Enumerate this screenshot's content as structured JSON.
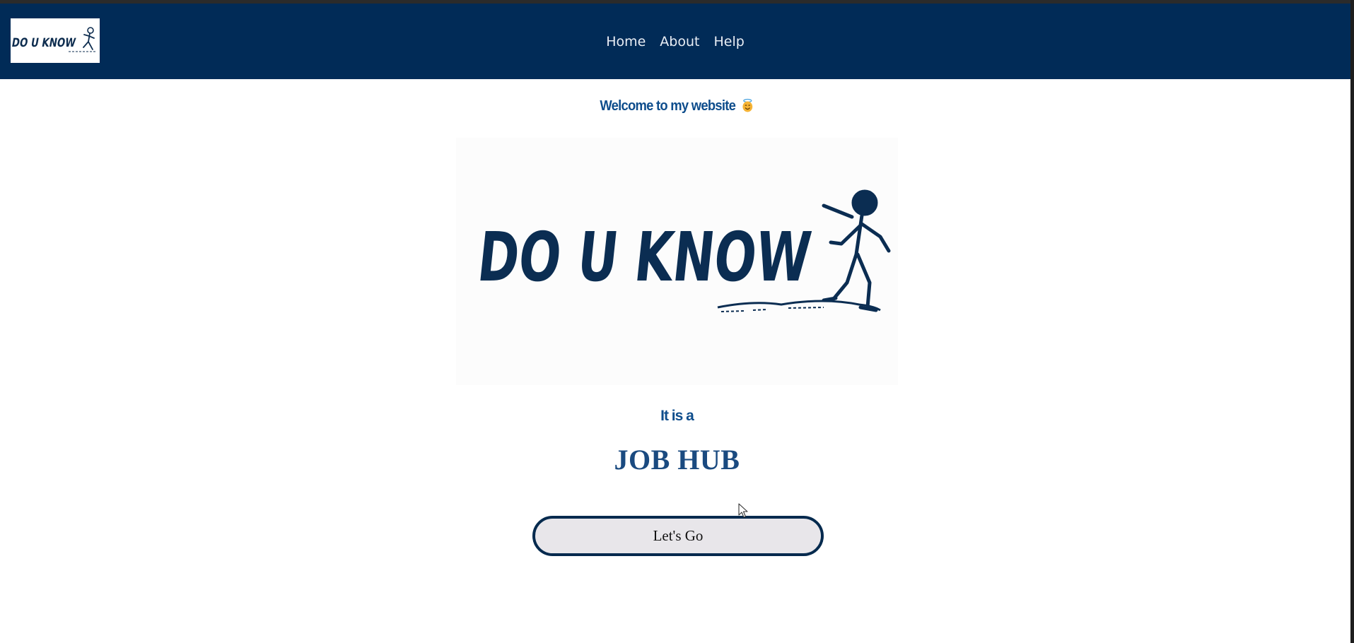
{
  "header": {
    "logo_text": "DO U KNOW",
    "nav": [
      {
        "label": "Home"
      },
      {
        "label": "About"
      },
      {
        "label": "Help"
      }
    ]
  },
  "main": {
    "welcome_text": "Welcome to my website",
    "welcome_emoji": "smiling-face-with-halo-icon",
    "hero_logo_text": "DO U KNOW",
    "intro_text": "It is a",
    "headline": "JOB HUB",
    "cta_label": "Let's Go"
  },
  "colors": {
    "navbar": "#012b57",
    "accent_text": "#0e4d8c",
    "button_border": "#052a4e",
    "button_fill": "#e8e6ea"
  }
}
